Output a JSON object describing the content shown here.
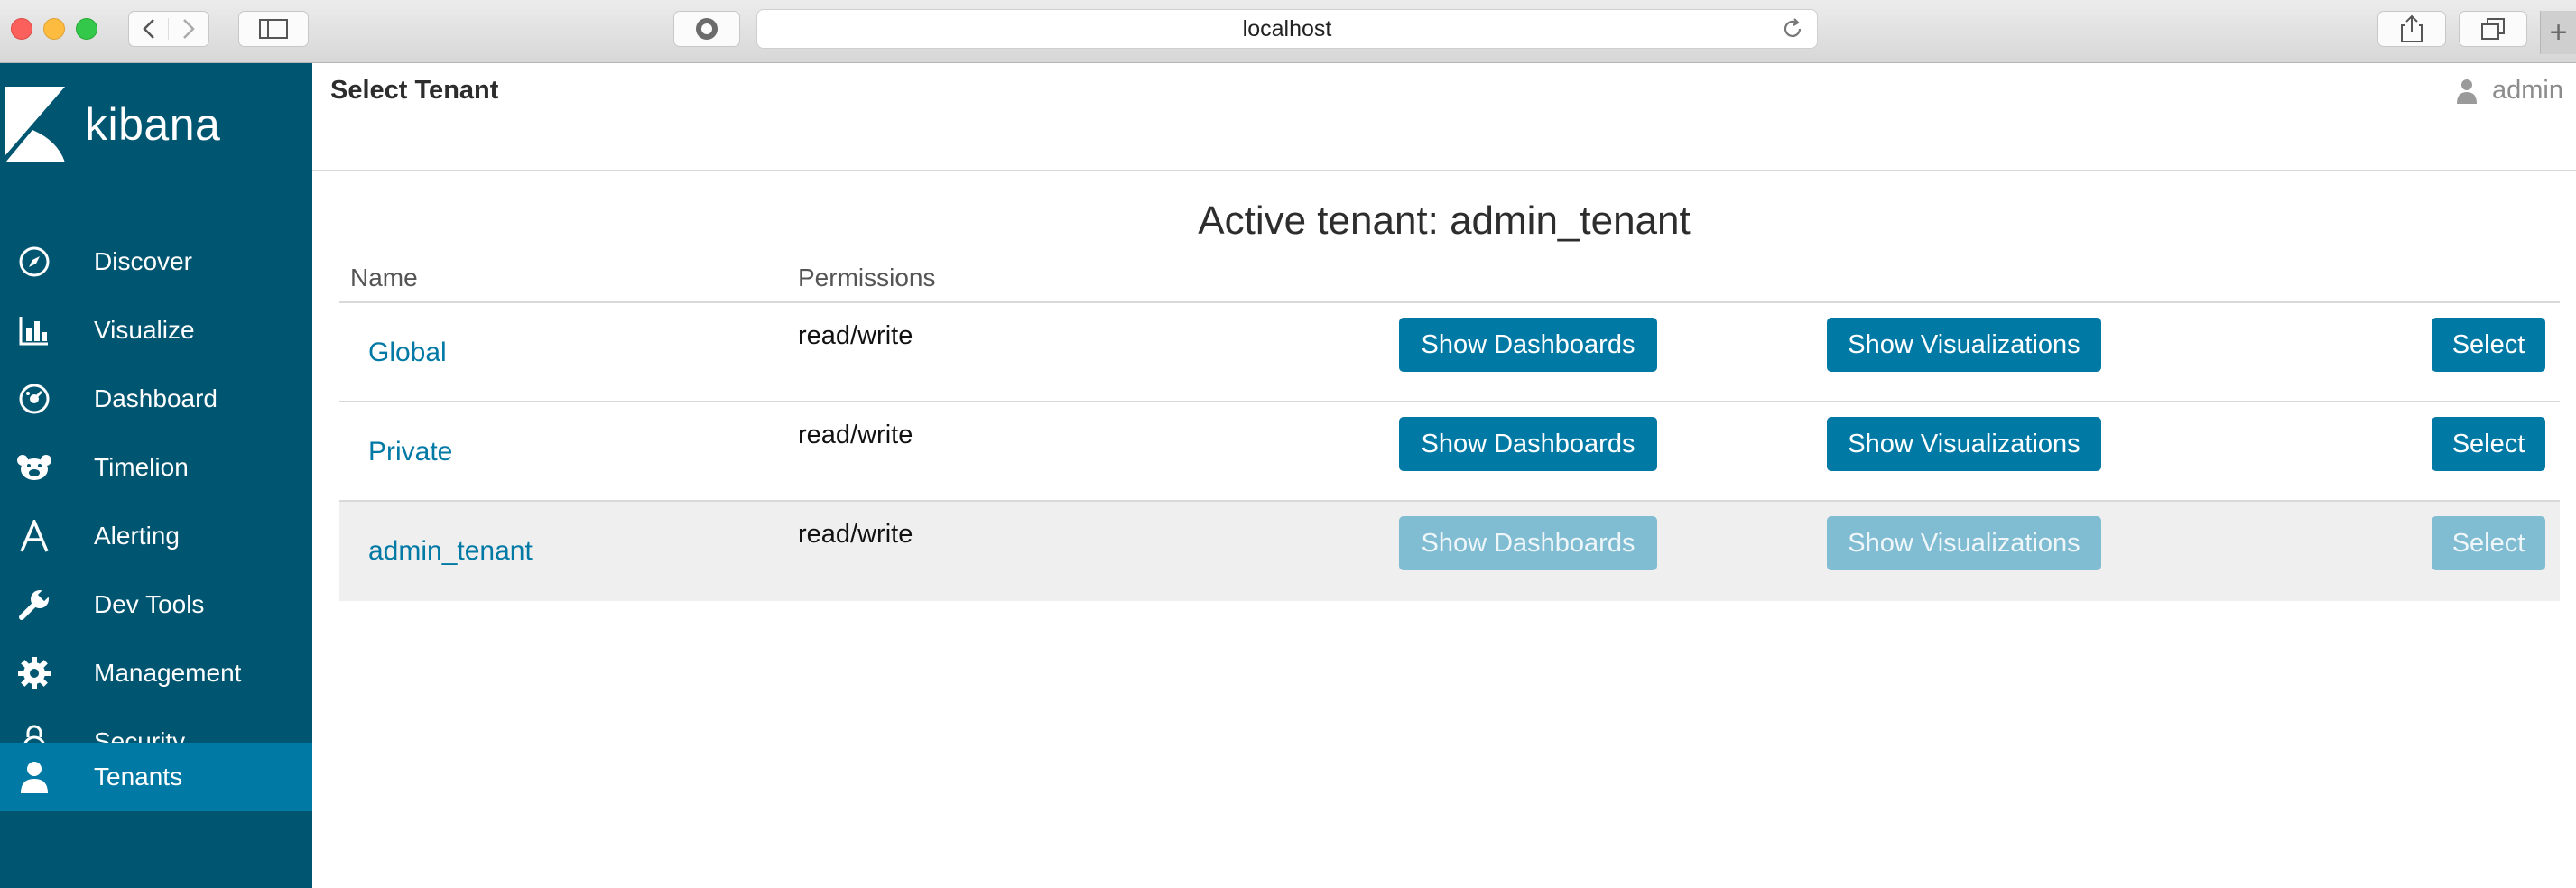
{
  "browser": {
    "url": "localhost"
  },
  "sidebar": {
    "logo": "kibana",
    "items": [
      {
        "label": "Discover",
        "icon": "compass-icon"
      },
      {
        "label": "Visualize",
        "icon": "bar-chart-icon"
      },
      {
        "label": "Dashboard",
        "icon": "dashboard-gauge-icon"
      },
      {
        "label": "Timelion",
        "icon": "timelion-bear-icon"
      },
      {
        "label": "Alerting",
        "icon": "alerting-a-icon"
      },
      {
        "label": "Dev Tools",
        "icon": "wrench-icon"
      },
      {
        "label": "Management",
        "icon": "gear-icon"
      },
      {
        "label": "Security",
        "icon": "lock-icon"
      },
      {
        "label": "Tenants",
        "icon": "user-icon",
        "active": true
      }
    ]
  },
  "header": {
    "title": "Select Tenant",
    "user": "admin"
  },
  "main": {
    "active_tenant_label": "Active tenant: admin_tenant",
    "columns": {
      "name": "Name",
      "permissions": "Permissions"
    },
    "buttons": {
      "dashboards": "Show Dashboards",
      "visualizations": "Show Visualizations",
      "select": "Select"
    },
    "tenants": [
      {
        "name": "Global",
        "permissions": "read/write",
        "current": false
      },
      {
        "name": "Private",
        "permissions": "read/write",
        "current": false
      },
      {
        "name": "admin_tenant",
        "permissions": "read/write",
        "current": true
      }
    ]
  },
  "colors": {
    "sidebar": "#005571",
    "active": "#0079a5",
    "button": "#0079a5",
    "button_disabled": "#80bcd2"
  }
}
